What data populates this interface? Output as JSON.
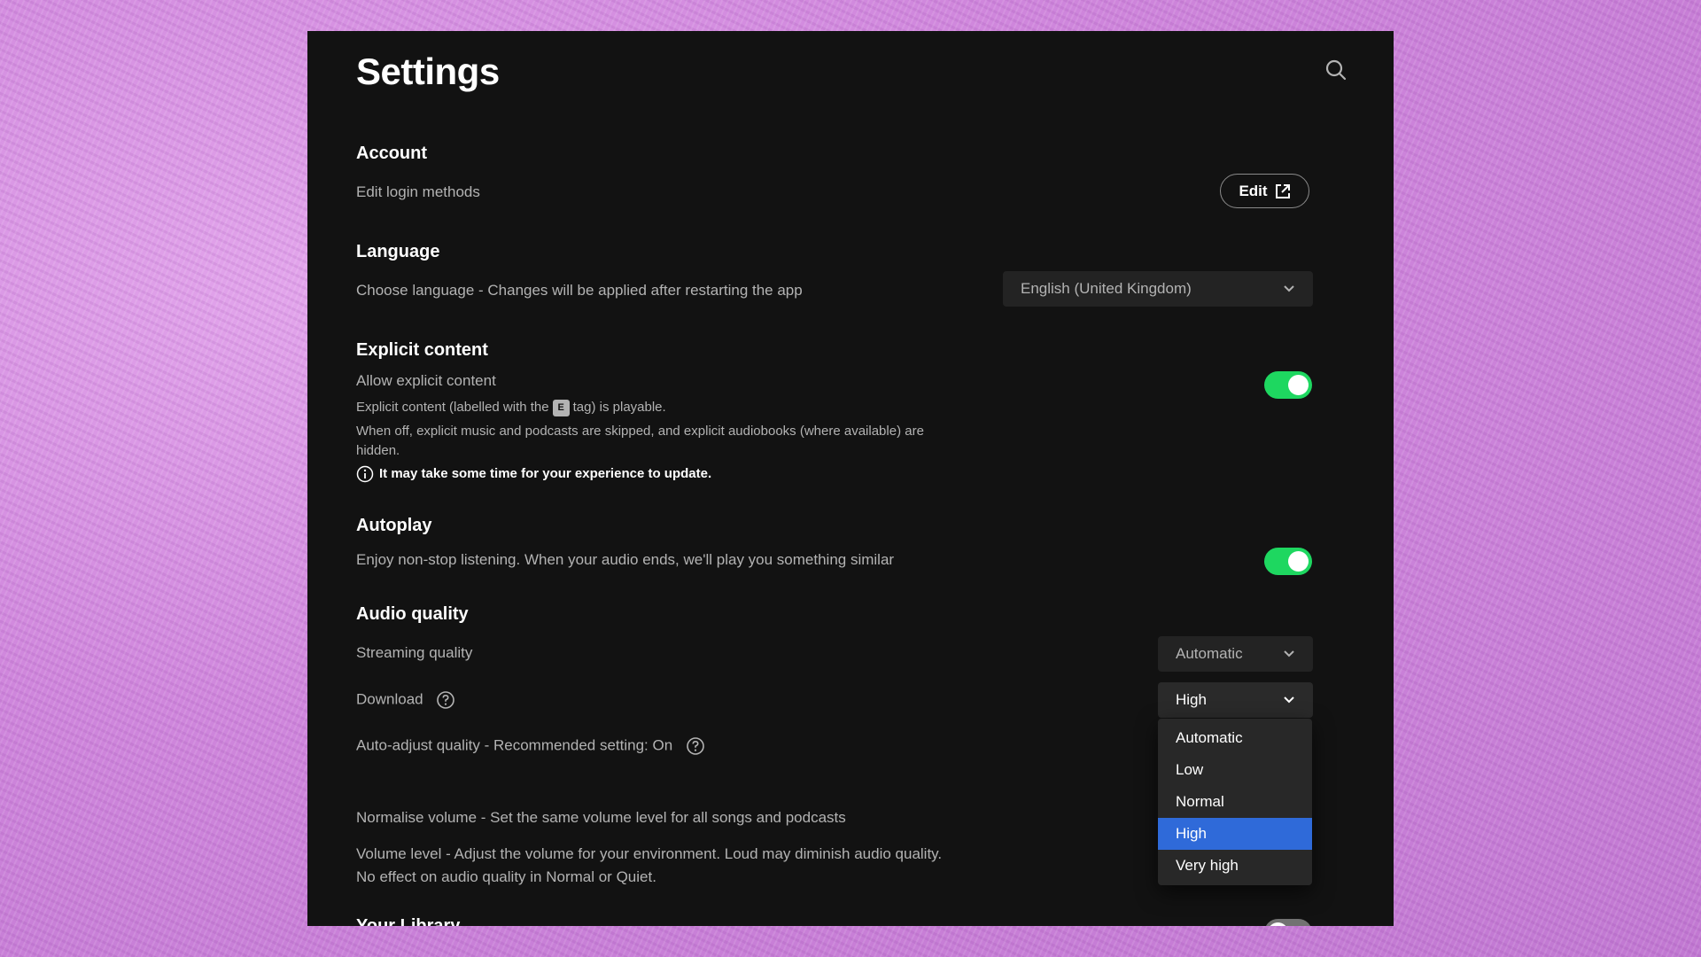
{
  "settings": {
    "title": "Settings",
    "account": {
      "title": "Account",
      "label": "Edit login methods",
      "edit_button": "Edit"
    },
    "language": {
      "title": "Language",
      "label": "Choose language - Changes will be applied after restarting the app",
      "selected": "English (United Kingdom)"
    },
    "explicit": {
      "title": "Explicit content",
      "label": "Allow explicit content",
      "enabled": true,
      "desc_before": "Explicit content (labelled with the",
      "tag": "E",
      "desc_after": "tag) is playable.",
      "desc2": "When off, explicit music and podcasts are skipped, and explicit audiobooks (where available) are hidden.",
      "note": "It may take some time for your experience to update."
    },
    "autoplay": {
      "title": "Autoplay",
      "label": "Enjoy non-stop listening. When your audio ends, we'll play you something similar",
      "enabled": true
    },
    "audio": {
      "title": "Audio quality",
      "streaming_label": "Streaming quality",
      "streaming_value": "Automatic",
      "download_label": "Download",
      "download_value": "High",
      "auto_adjust_label": "Auto-adjust quality - Recommended setting: On",
      "normalise_label": "Normalise volume - Set the same volume level for all songs and podcasts",
      "volume_label": "Volume level - Adjust the volume for your environment. Loud may diminish audio quality. No effect on audio quality in Normal or Quiet.",
      "download_options": [
        "Automatic",
        "Low",
        "Normal",
        "High",
        "Very high"
      ],
      "download_selected_index": 3
    },
    "library": {
      "title": "Your Library"
    }
  },
  "colors": {
    "accent_green": "#1ed760",
    "selection_blue": "#2f6ad9",
    "window_bg": "#121212"
  },
  "icons": {
    "search": "search-icon",
    "external_link": "external-link-icon",
    "chevron": "chevron-down-icon",
    "info": "info-icon",
    "help": "help-circle-icon"
  }
}
